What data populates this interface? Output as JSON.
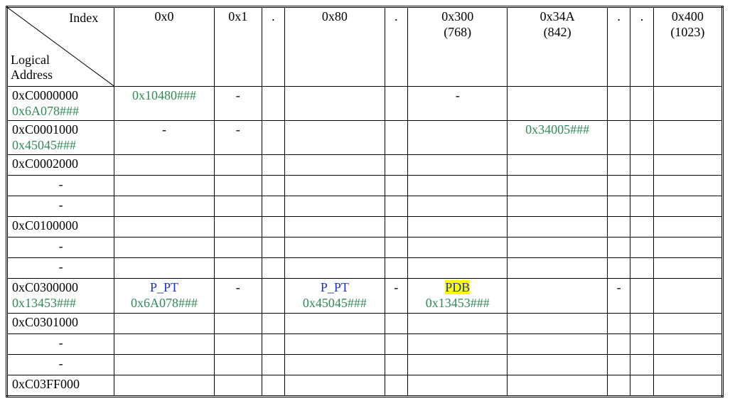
{
  "header": {
    "corner_top": "Index",
    "corner_bottom_line1": "Logical",
    "corner_bottom_line2": "Address",
    "cols": {
      "c0": {
        "l1": "0x0",
        "l2": ""
      },
      "c1": {
        "l1": "0x1",
        "l2": ""
      },
      "d1": {
        "l1": ".",
        "l2": ""
      },
      "c80": {
        "l1": "0x80",
        "l2": ""
      },
      "d2": {
        "l1": ".",
        "l2": ""
      },
      "c300": {
        "l1": "0x300",
        "l2": "(768)"
      },
      "c34a": {
        "l1": "0x34A",
        "l2": "(842)"
      },
      "d3": {
        "l1": ".",
        "l2": ""
      },
      "d4": {
        "l1": ".",
        "l2": ""
      },
      "c400": {
        "l1": "0x400",
        "l2": "(1023)"
      }
    }
  },
  "rows": {
    "r0": {
      "addr_main": "0xC0000000",
      "addr_sub": "0x6A078###",
      "c0": {
        "top": "",
        "bot": "0x10480###"
      },
      "c1": {
        "dash": "-"
      },
      "c300": {
        "dash": "-"
      }
    },
    "r1": {
      "addr_main": "0xC0001000",
      "addr_sub": "0x45045###",
      "c0": {
        "dash": "-"
      },
      "c1": {
        "dash": "-"
      },
      "c34a": {
        "top": "",
        "bot": "0x34005###"
      }
    },
    "r2": {
      "addr_main": "0xC0002000"
    },
    "r3": {
      "dash": "-"
    },
    "r4": {
      "dash": "-"
    },
    "r5": {
      "addr_main": "0xC0100000"
    },
    "r6": {
      "dash": "-"
    },
    "r7": {
      "dash": "-"
    },
    "r8": {
      "addr_main": "0xC0300000",
      "addr_sub": "0x13453###",
      "c0": {
        "top": "P_PT",
        "bot": "0x6A078###"
      },
      "c1": {
        "dash": "-"
      },
      "c80": {
        "top": "P_PT",
        "bot": "0x45045###"
      },
      "d2": {
        "dash": "-"
      },
      "c300": {
        "top": "PDB",
        "bot": "0x13453###"
      },
      "d3": {
        "dash": "-"
      }
    },
    "r9": {
      "addr_main": "0xC0301000"
    },
    "r10": {
      "dash": "-"
    },
    "r11": {
      "dash": "-"
    },
    "r12": {
      "addr_main": "0xC03FF000"
    }
  }
}
